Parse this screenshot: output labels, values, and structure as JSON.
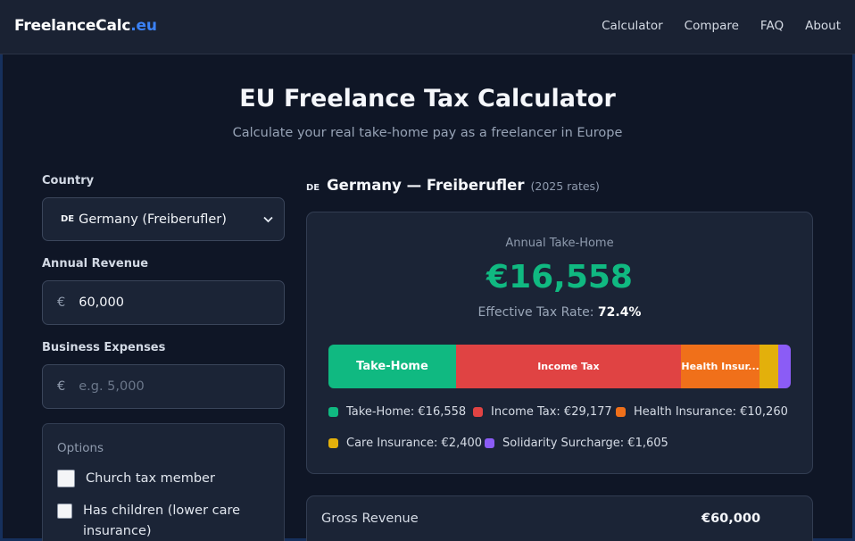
{
  "nav": {
    "brand_main": "FreelanceCalc",
    "brand_tld": ".eu",
    "links": [
      "Calculator",
      "Compare",
      "FAQ",
      "About"
    ]
  },
  "header": {
    "title": "EU Freelance Tax Calculator",
    "subtitle": "Calculate your real take-home pay as a freelancer in Europe"
  },
  "form": {
    "country_label": "Country",
    "country_flag": "DE",
    "country_value": "Germany (Freiberufler)",
    "revenue_label": "Annual Revenue",
    "revenue_currency": "€",
    "revenue_value": "60,000",
    "expenses_label": "Business Expenses",
    "expenses_currency": "€",
    "expenses_placeholder": "e.g. 5,000",
    "options_title": "Options",
    "options": [
      {
        "label": "Church tax member",
        "checked": false
      },
      {
        "label": "Has children (lower care insurance)",
        "checked": false
      }
    ]
  },
  "result": {
    "flag": "DE",
    "country_name": "Germany — Freiberufler",
    "rates_year": "(2025 rates)",
    "take_home_label": "Annual Take-Home",
    "take_home_value": "€16,558",
    "rate_label": "Effective Tax Rate:",
    "rate_value": "72.4%",
    "bar_segments": [
      {
        "label": "Take-Home",
        "amount": 16558,
        "color": "#10b981",
        "font": 13
      },
      {
        "label": "Income Tax",
        "amount": 29177,
        "color": "#e04343",
        "font": 11
      },
      {
        "label": "Health Insur...",
        "amount": 10260,
        "color": "#f0701a",
        "font": 11
      },
      {
        "label": "",
        "amount": 2400,
        "color": "#e3b00b",
        "font": 11
      },
      {
        "label": "",
        "amount": 1605,
        "color": "#8b5cf6",
        "font": 11
      }
    ],
    "legend": [
      {
        "label": "Take-Home: €16,558",
        "color": "#10b981"
      },
      {
        "label": "Income Tax: €29,177",
        "color": "#e04343"
      },
      {
        "label": "Health Insurance: €10,260",
        "color": "#f0701a"
      },
      {
        "label": "Care Insurance: €2,400",
        "color": "#e3b00b"
      },
      {
        "label": "Solidarity Surcharge: €1,605",
        "color": "#8b5cf6"
      }
    ]
  },
  "breakdown": {
    "rows": [
      {
        "label": "Gross Revenue",
        "value": "€60,000"
      }
    ]
  }
}
